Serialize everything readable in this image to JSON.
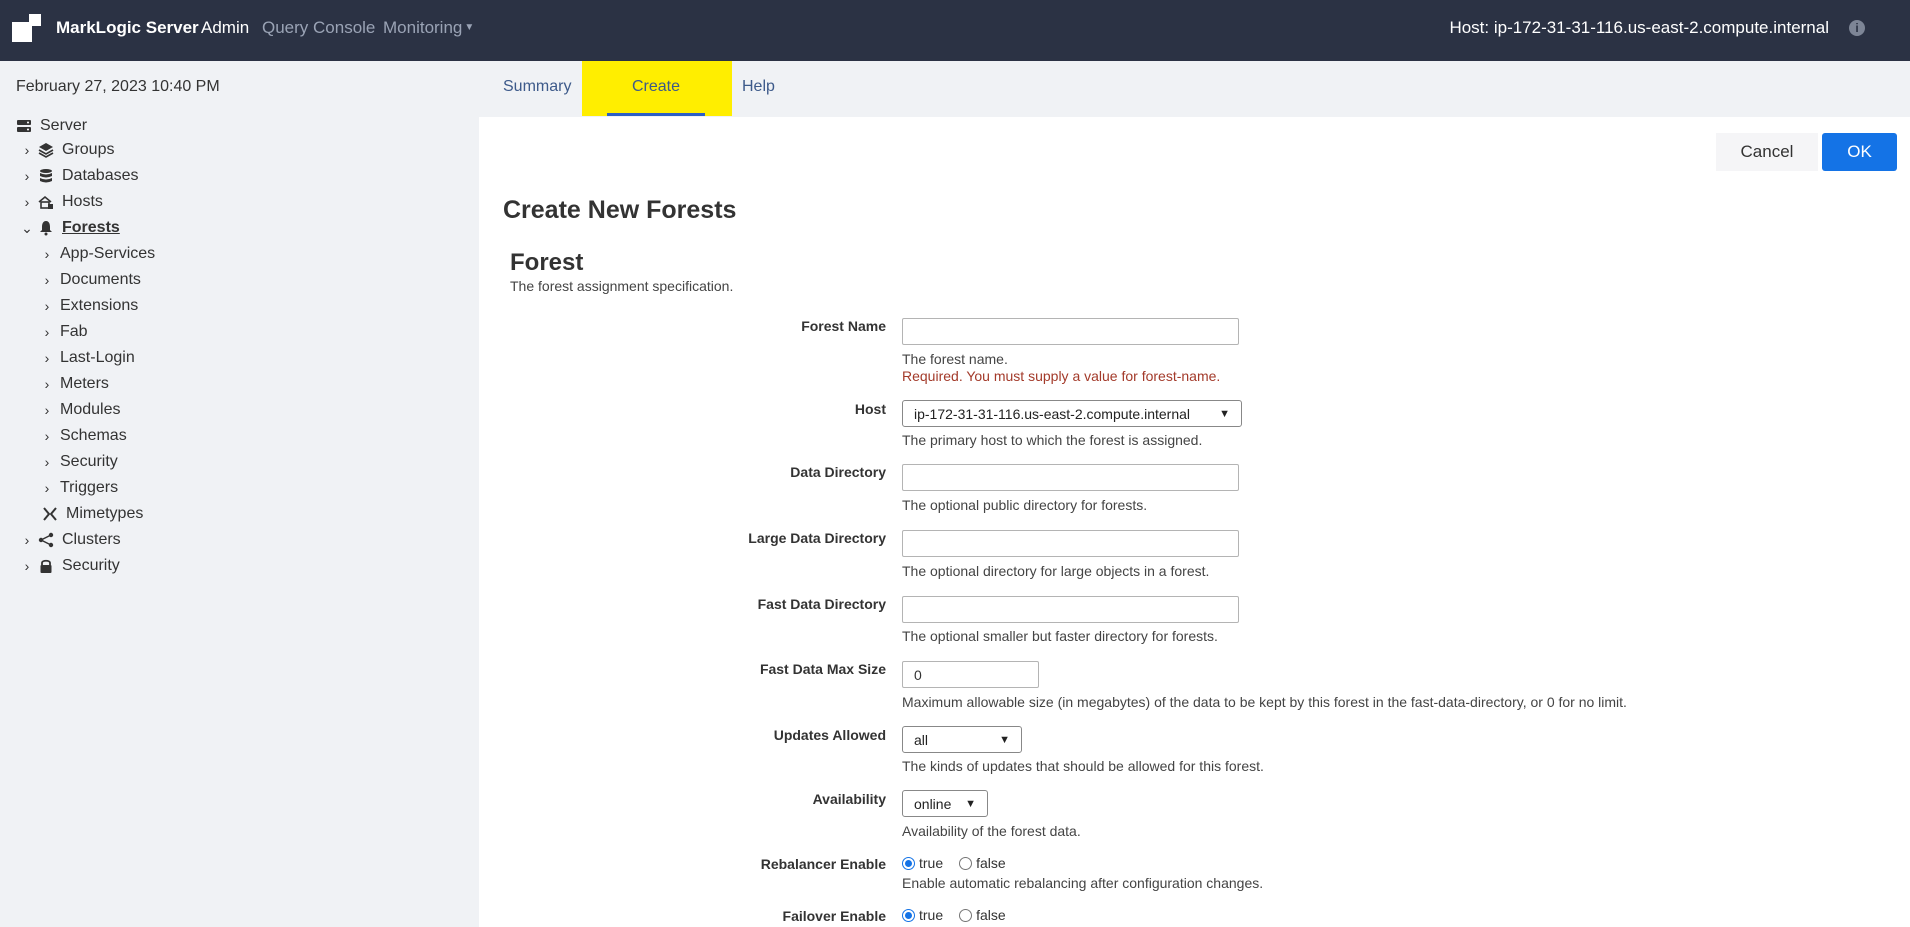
{
  "topbar": {
    "brand": "MarkLogic Server",
    "nav": {
      "admin": "Admin",
      "query_console": "Query Console",
      "monitoring": "Monitoring"
    },
    "host": "Host: ip-172-31-31-116.us-east-2.compute.internal"
  },
  "sidebar": {
    "date": "February 27, 2023 10:40 PM",
    "server": "Server",
    "groups": "Groups",
    "databases": "Databases",
    "hosts": "Hosts",
    "forests": "Forests",
    "forest_children": [
      "App-Services",
      "Documents",
      "Extensions",
      "Fab",
      "Last-Login",
      "Meters",
      "Modules",
      "Schemas",
      "Security",
      "Triggers"
    ],
    "mimetypes": "Mimetypes",
    "clusters": "Clusters",
    "security": "Security"
  },
  "tabs": {
    "summary": "Summary",
    "create": "Create",
    "help": "Help"
  },
  "actions": {
    "cancel": "Cancel",
    "ok": "OK"
  },
  "page": {
    "title": "Create New Forests",
    "section": "Forest",
    "section_desc": "The forest assignment specification."
  },
  "form": {
    "forest_name": {
      "label": "Forest Name",
      "value": "",
      "desc": "The forest name.",
      "error": "Required. You must supply a value for forest-name."
    },
    "host": {
      "label": "Host",
      "value": "ip-172-31-31-116.us-east-2.compute.internal",
      "desc": "The primary host to which the forest is assigned."
    },
    "data_directory": {
      "label": "Data Directory",
      "value": "",
      "desc": "The optional public directory for forests."
    },
    "large_data_directory": {
      "label": "Large Data Directory",
      "value": "",
      "desc": "The optional directory for large objects in a forest."
    },
    "fast_data_directory": {
      "label": "Fast Data Directory",
      "value": "",
      "desc": "The optional smaller but faster directory for forests."
    },
    "fast_data_max_size": {
      "label": "Fast Data Max Size",
      "value": "0",
      "desc": "Maximum allowable size (in megabytes) of the data to be kept by this forest in the fast-data-directory, or 0 for no limit."
    },
    "updates_allowed": {
      "label": "Updates Allowed",
      "value": "all",
      "desc": "The kinds of updates that should be allowed for this forest."
    },
    "availability": {
      "label": "Availability",
      "value": "online",
      "desc": "Availability of the forest data."
    },
    "rebalancer_enable": {
      "label": "Rebalancer Enable",
      "true_label": "true",
      "false_label": "false",
      "selected": "true",
      "desc": "Enable automatic rebalancing after configuration changes."
    },
    "failover_enable": {
      "label": "Failover Enable",
      "true_label": "true",
      "false_label": "false",
      "selected": "true"
    }
  }
}
